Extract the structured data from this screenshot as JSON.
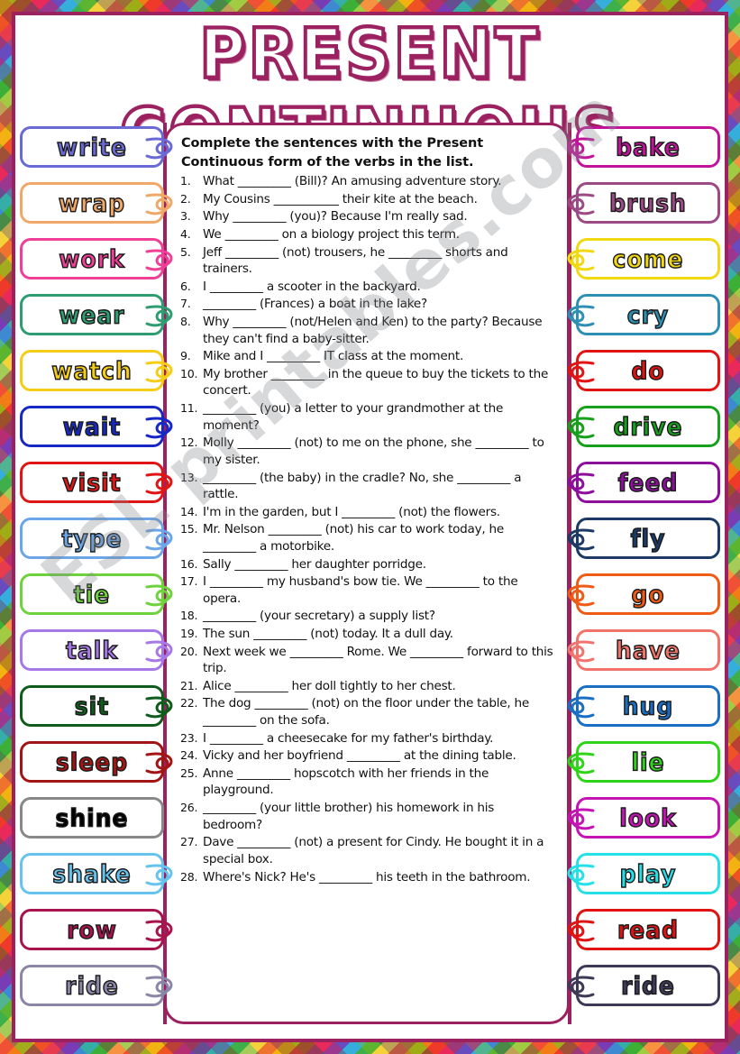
{
  "title": "PRESENT CONTINUOUS",
  "watermark": "ESL printables.com",
  "theme": {
    "frame_color": "#9c2160",
    "panel_border": "#9c2160",
    "paper": "#ffffff"
  },
  "instruction": "Complete the sentences with the Present Continuous form of the verbs in the list.",
  "left_words": [
    {
      "word": "write",
      "color": "#6a6ad6"
    },
    {
      "word": "wrap",
      "color": "#f0a868"
    },
    {
      "word": "work",
      "color": "#ef3f96"
    },
    {
      "word": "wear",
      "color": "#2e9e72"
    },
    {
      "word": "watch",
      "color": "#f5cc16"
    },
    {
      "word": "wait",
      "color": "#1728c4"
    },
    {
      "word": "visit",
      "color": "#e01616"
    },
    {
      "word": "type",
      "color": "#6aa6e8"
    },
    {
      "word": "tie",
      "color": "#6ed23c"
    },
    {
      "word": "talk",
      "color": "#a678e8"
    },
    {
      "word": "sit",
      "color": "#0f5c1c"
    },
    {
      "word": "sleep",
      "color": "#a31414"
    },
    {
      "word": "shine",
      "color": "#f5a game"
    },
    {
      "word": "shake",
      "color": "#66c3ee"
    },
    {
      "word": "row",
      "color": "#a8144e"
    },
    {
      "word": "ride",
      "color": "#8a86a8"
    }
  ],
  "right_words": [
    {
      "word": "bake",
      "color": "#c2139b"
    },
    {
      "word": "brush",
      "color": "#9c4a86"
    },
    {
      "word": "come",
      "color": "#f2d811"
    },
    {
      "word": "cry",
      "color": "#2e8fb4"
    },
    {
      "word": "do",
      "color": "#e11414"
    },
    {
      "word": "drive",
      "color": "#17a01c"
    },
    {
      "word": "feed",
      "color": "#8c0f9c"
    },
    {
      "word": "fly",
      "color": "#1c3a66"
    },
    {
      "word": "go",
      "color": "#ef5a15"
    },
    {
      "word": "have",
      "color": "#f2736b"
    },
    {
      "word": "hug",
      "color": "#1a6fc4"
    },
    {
      "word": "lie",
      "color": "#2fd41a"
    },
    {
      "word": "look",
      "color": "#c415b4"
    },
    {
      "word": "play",
      "color": "#26e0e8"
    },
    {
      "word": "read",
      "color": "#e01212"
    },
    {
      "word": "ride",
      "color": "#3c3a56"
    }
  ],
  "questions": [
    "What _________ (Bill)? An amusing adventure story.",
    "My Cousins ___________ their kite at the beach.",
    "Why _________ (you)? Because I'm really sad.",
    "We _________ on a biology project this term.",
    "Jeff _________ (not) trousers, he _________ shorts and trainers.",
    "I _________ a scooter in the backyard.",
    "_________ (Frances) a boat in the lake?",
    "Why _________ (not/Helen and Ken) to the party? Because they can't find a baby-sitter.",
    "Mike and I _________ IT class at the moment.",
    "My brother _________ in the queue to buy the tickets to the concert.",
    "_________ (you) a letter to your grandmother at the moment?",
    "Molly _________ (not) to me on the phone, she _________ to my sister.",
    "_________ (the baby) in the cradle? No, she _________ a rattle.",
    "I'm in the garden, but I _________ (not) the flowers.",
    "Mr. Nelson _________ (not) his car to work today, he _________ a motorbike.",
    "Sally _________ her daughter porridge.",
    "I _________ my husband's bow tie. We _________ to the opera.",
    "_________ (your secretary) a supply list?",
    "The sun _________ (not) today. It a dull day.",
    "Next week we _________ Rome. We _________ forward to this trip.",
    "Alice _________ her doll tightly to her chest.",
    "The dog _________ (not) on the floor under the table, he _________ on the sofa.",
    "I _________ a cheesecake for my father's birthday.",
    "Vicky and her boyfriend _________ at the dining table.",
    "Anne _________ hopscotch with her friends in the playground.",
    "_________ (your little brother) his homework in his bedroom?",
    "Dave _________ (not) a present for Cindy. He bought it in a special box.",
    "Where's Nick? He's _________ his teeth in the bathroom."
  ]
}
